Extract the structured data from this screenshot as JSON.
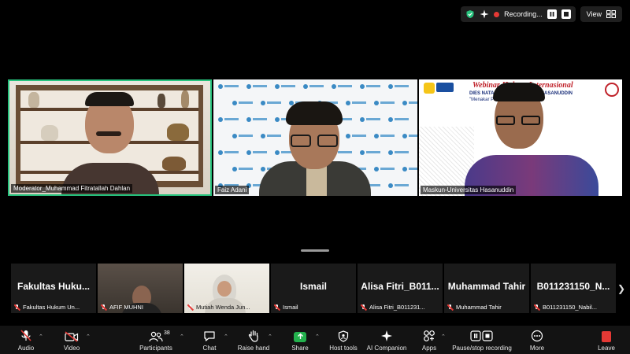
{
  "topbar": {
    "recording_label": "Recording...",
    "view_label": "View",
    "shield_color": "#27c27d"
  },
  "main_tiles": [
    {
      "name": "Moderator_Muhammad Fitratallah Dahlan",
      "active_speaker": true
    },
    {
      "name": "Faiz Adani"
    },
    {
      "name": "Maskun-Universitas Hasanuddin"
    }
  ],
  "tile3_banner": {
    "title": "Webinar Hukum Internasional",
    "line1": "DIES NATALIS ... UNIVERSITAS HASANUDDIN",
    "line2": "\"Menakar Per... Rusia atas Ukraina\""
  },
  "thumbnails": [
    {
      "big_name": "Fakultas  Huku...",
      "label": "Fakultas Hukum Un...",
      "video": false
    },
    {
      "big_name": "",
      "label": "AFIF MUHNI",
      "video": true
    },
    {
      "big_name": "",
      "label": "Mutiah Wenda Jun...",
      "video": true
    },
    {
      "big_name": "Ismail",
      "label": "Ismail",
      "video": false
    },
    {
      "big_name": "Alisa Fitri_B011...",
      "label": "Alisa Fitri_B011231...",
      "video": false
    },
    {
      "big_name": "Muhammad Tahir",
      "label": "Muhammad Tahir",
      "video": false
    },
    {
      "big_name": "B011231150_N...",
      "label": "B011231150_Nabil...",
      "video": false
    }
  ],
  "toolbar": {
    "audio": "Audio",
    "video": "Video",
    "participants": "Participants",
    "participants_count": "38",
    "chat": "Chat",
    "raise_hand": "Raise hand",
    "share": "Share",
    "host_tools": "Host tools",
    "ai_companion": "AI Companion",
    "apps": "Apps",
    "pause_recording": "Pause/stop recording",
    "more": "More",
    "leave": "Leave"
  }
}
